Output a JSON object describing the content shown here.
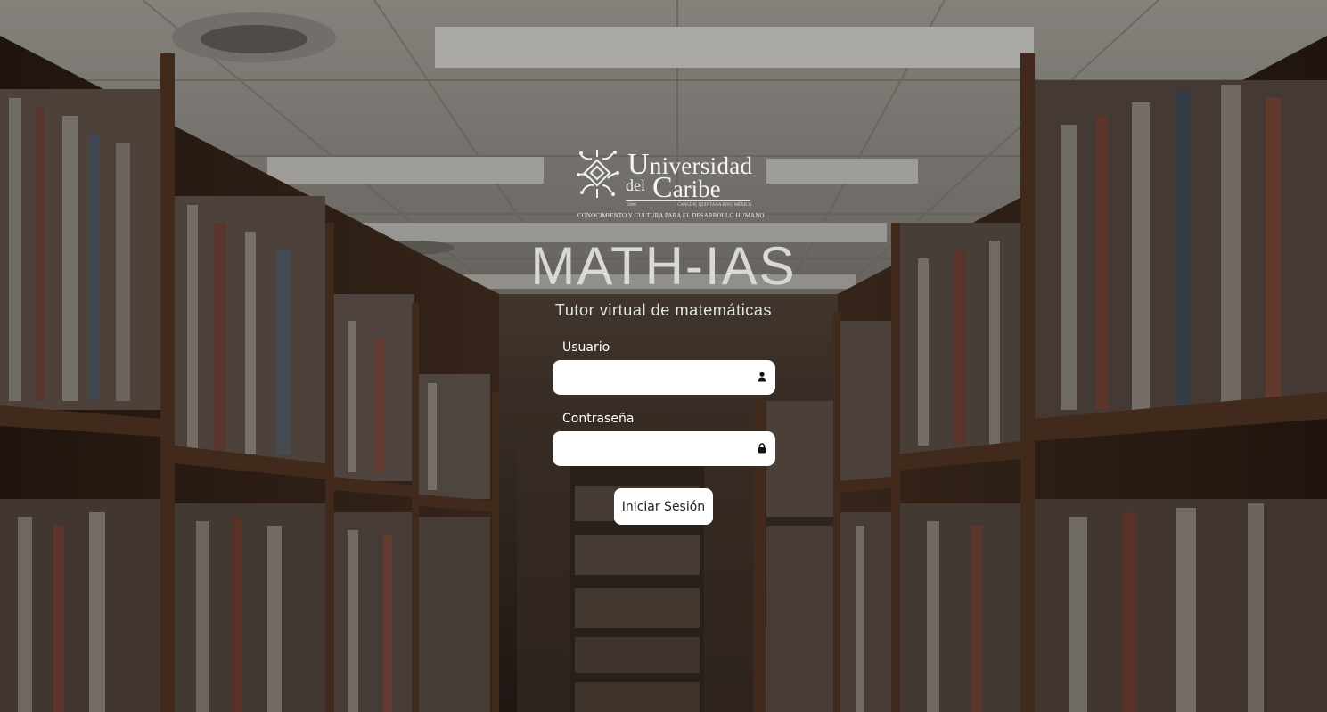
{
  "logo": {
    "line1_cap": "U",
    "line1_rest": "niversidad",
    "line2_small": "del",
    "line2_cap": "C",
    "line2_rest": "aribe",
    "year": "2000",
    "location": "CANCÚN, QUINTANA ROO, MÉXICO",
    "motto": "CONOCIMIENTO Y CULTURA PARA EL DESARROLLO HUMANO"
  },
  "app": {
    "title": "MATH-IAS",
    "subtitle": "Tutor virtual de matemáticas"
  },
  "form": {
    "username_label": "Usuario",
    "username_value": "",
    "username_icon": "user-icon",
    "password_label": "Contraseña",
    "password_value": "",
    "password_icon": "lock-icon",
    "submit_label": "Iniciar Sesión"
  },
  "colors": {
    "text": "#ffffff",
    "title": "#d8d8d8",
    "field_bg": "#ffffff",
    "button_bg": "#ffffff"
  }
}
